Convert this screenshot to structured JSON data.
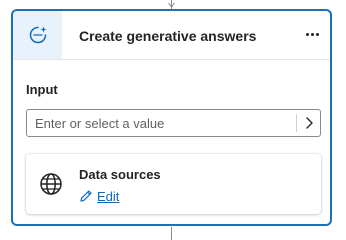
{
  "node": {
    "title": "Create generative answers",
    "header_icon": "generative-answers-icon",
    "more_icon": "more-options-icon",
    "accent_color": "#1f6fb3"
  },
  "input_section": {
    "label": "Input",
    "field": {
      "value": "",
      "placeholder": "Enter or select a value",
      "chevron_icon": "chevron-right-icon"
    }
  },
  "data_sources": {
    "title": "Data sources",
    "icon": "globe-icon",
    "edit_label": "Edit",
    "edit_icon": "pencil-icon",
    "link_color": "#0f6cbd"
  }
}
